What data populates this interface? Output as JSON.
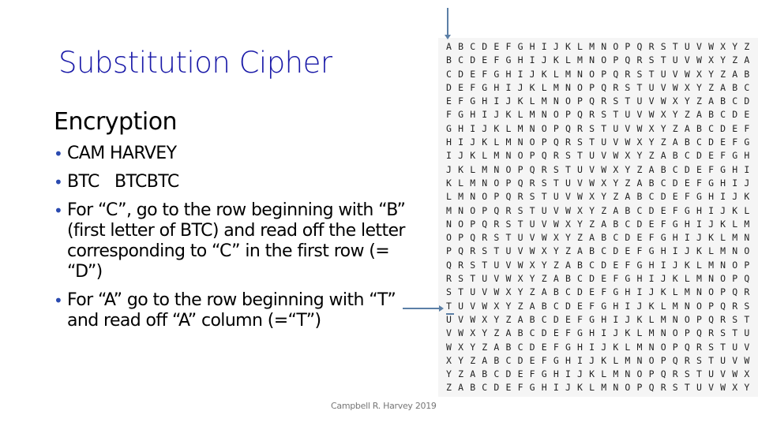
{
  "slide": {
    "title": "Substitution Cipher",
    "subheading": "Encryption",
    "bullets": [
      "CAM HARVEY",
      "BTC   BTCBTC",
      "For “C”, go to the row beginning with “B” (first letter of BTC) and read off the letter corresponding to “C” in the first row (= “D”)",
      "For “A” go to the row beginning with “T” and read off “A” column (=“T”)"
    ],
    "bullet_glyph": "•",
    "footer": "Campbell R. Harvey 2019"
  },
  "vigenere_table": {
    "alphabet": "ABCDEFGHIJKLMNOPQRSTUVWXYZ",
    "highlight_column": "A",
    "highlight_row": "T"
  },
  "colors": {
    "title": "#1a1aa8",
    "bullet": "#2a4ab0",
    "arrow": "#5b7fa6",
    "table_bg": "#f5f5f5"
  }
}
